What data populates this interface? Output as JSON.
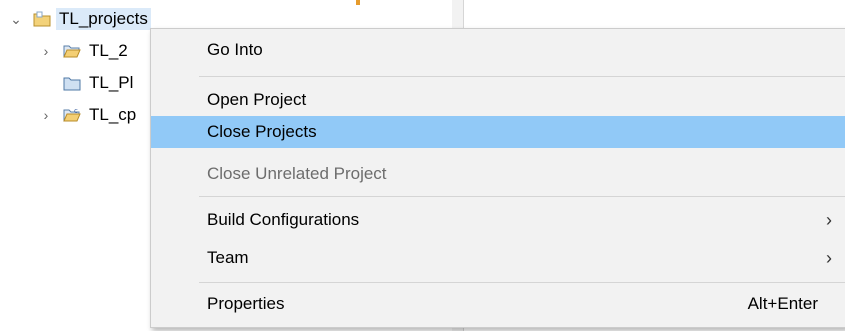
{
  "tree": {
    "root": {
      "label": "TL_projects",
      "expanded": true,
      "icon": "working-set-folder-icon"
    },
    "children": [
      {
        "label": "TL_2",
        "twisty": "›",
        "icon": "open-project-folder-icon"
      },
      {
        "label": "TL_Pl",
        "twisty": "",
        "icon": "closed-project-folder-icon"
      },
      {
        "label": "TL_cp",
        "twisty": "›",
        "icon": "c-project-folder-icon"
      }
    ]
  },
  "context_menu": {
    "items": [
      {
        "label": "Go Into",
        "state": "normal"
      },
      {
        "label": "Open Project",
        "state": "normal"
      },
      {
        "label": "Close Projects",
        "state": "highlighted"
      },
      {
        "label": "Close Unrelated Project",
        "state": "disabled"
      },
      {
        "label": "Build Configurations",
        "submenu": "›"
      },
      {
        "label": "Team",
        "submenu": "›"
      },
      {
        "label": "Properties",
        "shortcut": "Alt+Enter"
      }
    ]
  },
  "colors": {
    "menu_background": "#f2f2f2",
    "highlight": "#91c9f7",
    "tree_selection": "#dbeaf9",
    "disabled_text": "#6d6d6d"
  }
}
